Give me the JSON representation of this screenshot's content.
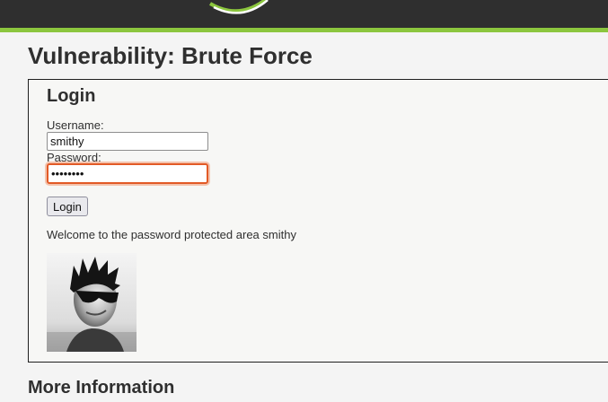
{
  "page": {
    "title": "Vulnerability: Brute Force",
    "more_info_heading": "More Information"
  },
  "login_form": {
    "heading": "Login",
    "username_label": "Username:",
    "username_value": "smithy",
    "password_label": "Password:",
    "password_value": "password",
    "submit_label": "Login"
  },
  "result": {
    "welcome_message": "Welcome to the password protected area smithy"
  },
  "colors": {
    "header_bg": "#2f2f2f",
    "header_accent": "#8cc63e",
    "focus_border": "#e25a26"
  },
  "icons": {
    "logo": "swoosh-logo-icon",
    "avatar": "user-avatar-photo"
  }
}
